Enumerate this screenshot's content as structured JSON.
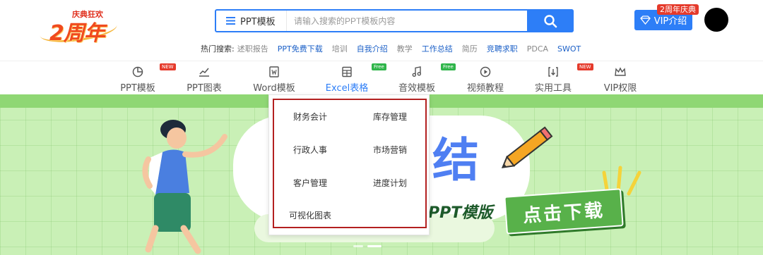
{
  "header": {
    "logo": {
      "badge_text": "庆典狂欢",
      "main_text": "2周年"
    },
    "search": {
      "category_label": "PPT模板",
      "placeholder": "请输入搜索的PPT模板内容"
    },
    "hot_search": {
      "label": "热门搜索:",
      "items": [
        {
          "text": "述职报告",
          "style": "gray"
        },
        {
          "text": "PPT免费下载",
          "style": "blue"
        },
        {
          "text": "培训",
          "style": "gray"
        },
        {
          "text": "自我介绍",
          "style": "blue"
        },
        {
          "text": "教学",
          "style": "gray"
        },
        {
          "text": "工作总结",
          "style": "blue"
        },
        {
          "text": "简历",
          "style": "gray"
        },
        {
          "text": "竞聘求职",
          "style": "blue"
        },
        {
          "text": "PDCA",
          "style": "gray"
        },
        {
          "text": "SWOT",
          "style": "blue"
        }
      ]
    },
    "vip": {
      "label": "VIP介绍",
      "badge": "2周年庆典"
    }
  },
  "nav": {
    "items": [
      {
        "label": "PPT模板",
        "icon": "pie-chart-icon",
        "tag": "NEW",
        "tag_type": "new"
      },
      {
        "label": "PPT图表",
        "icon": "line-chart-icon",
        "tag": "",
        "tag_type": ""
      },
      {
        "label": "Word模板",
        "icon": "word-doc-icon",
        "tag": "",
        "tag_type": ""
      },
      {
        "label": "Excel表格",
        "icon": "spreadsheet-icon",
        "tag": "Free",
        "tag_type": "free",
        "active": true
      },
      {
        "label": "音效模板",
        "icon": "music-note-icon",
        "tag": "Free",
        "tag_type": "free"
      },
      {
        "label": "视频教程",
        "icon": "play-circle-icon",
        "tag": "",
        "tag_type": ""
      },
      {
        "label": "实用工具",
        "icon": "tools-icon",
        "tag": "NEW",
        "tag_type": "new"
      },
      {
        "label": "VIP权限",
        "icon": "crown-icon",
        "tag": "",
        "tag_type": ""
      }
    ]
  },
  "dropdown": {
    "items": [
      "财务会计",
      "库存管理",
      "行政人事",
      "市场营销",
      "客户管理",
      "进度计划",
      "可视化图表"
    ]
  },
  "banner": {
    "big_char": "结",
    "subtitle": "PPT模版",
    "download_label": "点击下载"
  },
  "colors": {
    "primary": "#2d7ef7",
    "banner_bg": "#c9f0b6",
    "download_btn": "#58b14a",
    "dropdown_border": "#b32020"
  }
}
